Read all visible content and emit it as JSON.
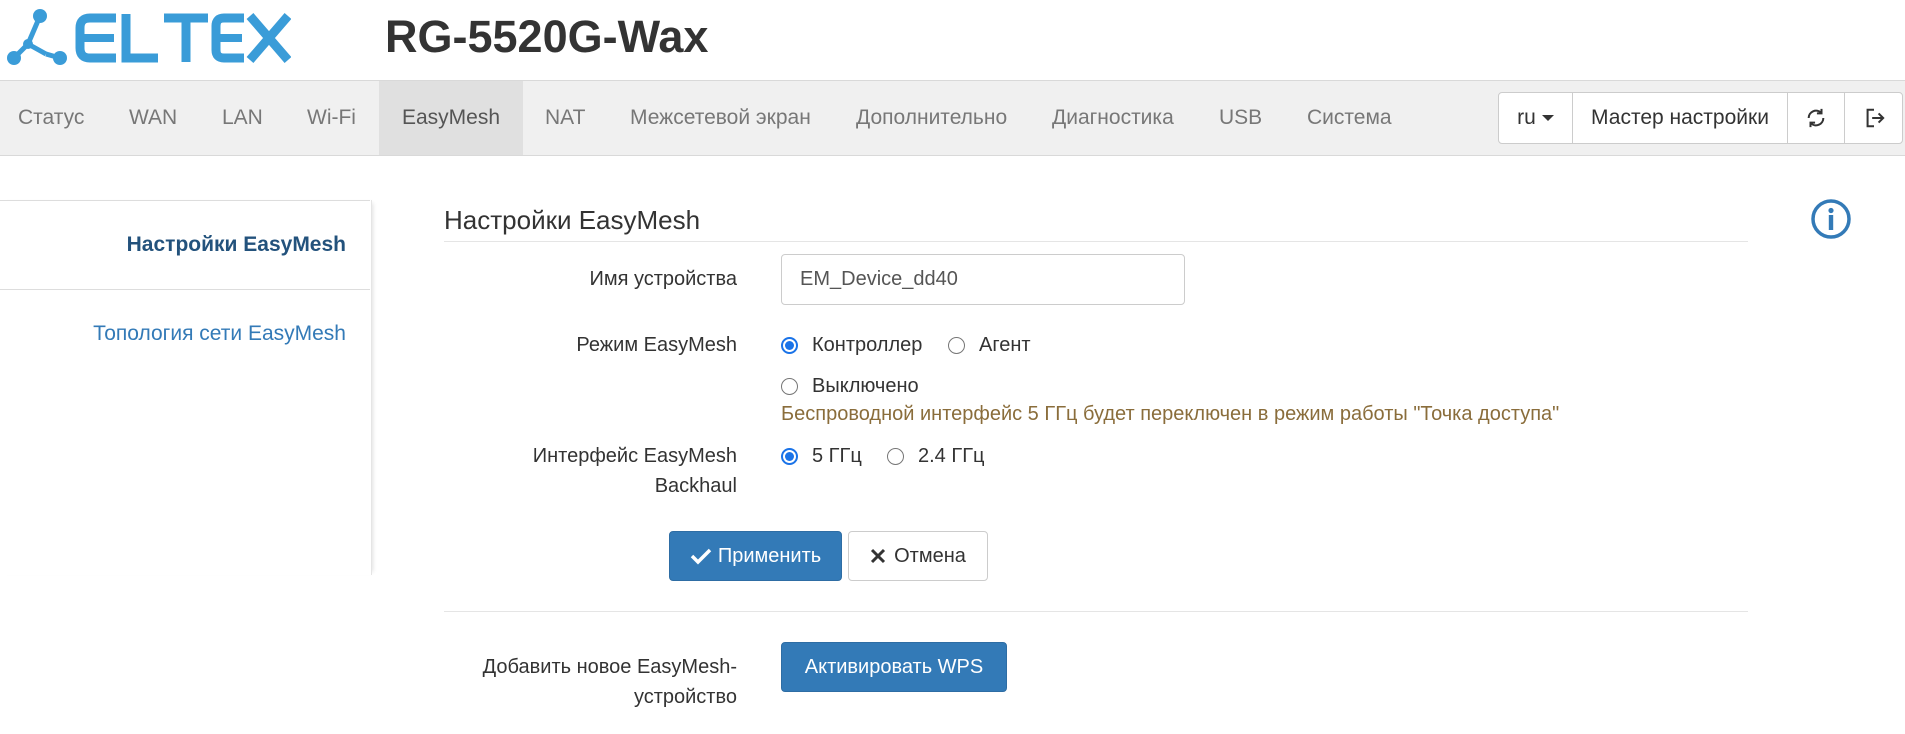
{
  "brand": {
    "logo_text": "ELTEX",
    "model": "RG-5520G-Wax",
    "logo_color": "#3a9cd8"
  },
  "nav": {
    "items": [
      "Статус",
      "WAN",
      "LAN",
      "Wi-Fi",
      "EasyMesh",
      "NAT",
      "Межсетевой экран",
      "Дополнительно",
      "Диагностика",
      "USB",
      "Система"
    ],
    "active": "EasyMesh",
    "lang": "ru",
    "wizard": "Мастер настройки",
    "refresh_icon": "refresh-icon",
    "logout_icon": "logout-icon"
  },
  "sidebar": {
    "items": [
      {
        "label": "Настройки EasyMesh",
        "active": true
      },
      {
        "label": "Топология сети EasyMesh",
        "active": false
      }
    ]
  },
  "main": {
    "title": "Настройки EasyMesh",
    "device_name_label": "Имя устройства",
    "device_name_value": "EM_Device_dd40",
    "mode_label": "Режим EasyMesh",
    "mode_options": [
      "Контроллер",
      "Агент",
      "Выключено"
    ],
    "mode_selected": "Контроллер",
    "warning": "Беспроводной интерфейс 5 ГГц будет переключен в режим работы \"Точка доступа\"",
    "backhaul_label_line1": "Интерфейс EasyMesh",
    "backhaul_label_line2": "Backhaul",
    "backhaul_options": [
      "5 ГГц",
      "2.4 ГГц"
    ],
    "backhaul_selected": "5 ГГц",
    "apply": "Применить",
    "cancel": "Отмена",
    "add_label_line1": "Добавить новое EasyMesh-",
    "add_label_line2": "устройство",
    "wps": "Активировать WPS"
  },
  "colors": {
    "primary": "#337ab7",
    "link": "#337ab7",
    "active_text": "#23527c",
    "warning": "#8a6d3b"
  }
}
